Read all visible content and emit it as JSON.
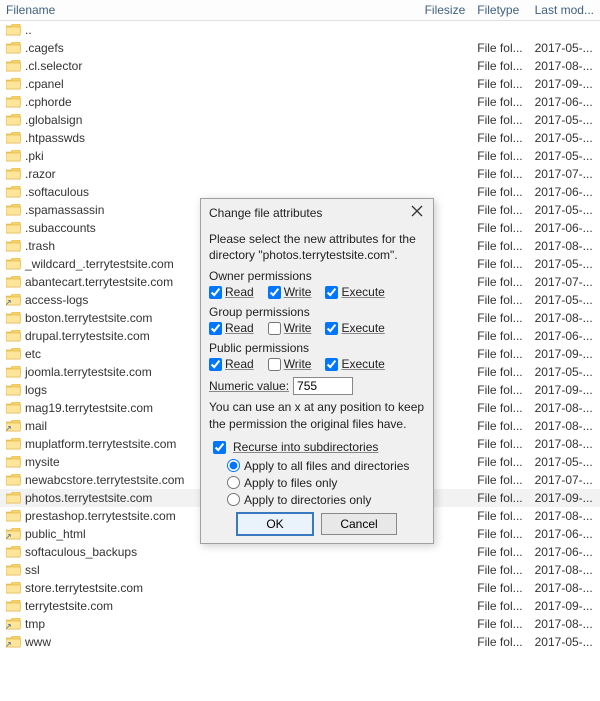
{
  "columns": {
    "filename": "Filename",
    "filesize": "Filesize",
    "filetype": "Filetype",
    "lastmod": "Last mod..."
  },
  "rows": [
    {
      "name": "..",
      "filetype": "",
      "lastmod": "",
      "shortcut": false,
      "selected": false
    },
    {
      "name": ".cagefs",
      "filetype": "File fol...",
      "lastmod": "2017-05-...",
      "shortcut": false,
      "selected": false
    },
    {
      "name": ".cl.selector",
      "filetype": "File fol...",
      "lastmod": "2017-08-...",
      "shortcut": false,
      "selected": false
    },
    {
      "name": ".cpanel",
      "filetype": "File fol...",
      "lastmod": "2017-09-...",
      "shortcut": false,
      "selected": false
    },
    {
      "name": ".cphorde",
      "filetype": "File fol...",
      "lastmod": "2017-06-...",
      "shortcut": false,
      "selected": false
    },
    {
      "name": ".globalsign",
      "filetype": "File fol...",
      "lastmod": "2017-05-...",
      "shortcut": false,
      "selected": false
    },
    {
      "name": ".htpasswds",
      "filetype": "File fol...",
      "lastmod": "2017-05-...",
      "shortcut": false,
      "selected": false
    },
    {
      "name": ".pki",
      "filetype": "File fol...",
      "lastmod": "2017-05-...",
      "shortcut": false,
      "selected": false
    },
    {
      "name": ".razor",
      "filetype": "File fol...",
      "lastmod": "2017-07-...",
      "shortcut": false,
      "selected": false
    },
    {
      "name": ".softaculous",
      "filetype": "File fol...",
      "lastmod": "2017-06-...",
      "shortcut": false,
      "selected": false
    },
    {
      "name": ".spamassassin",
      "filetype": "File fol...",
      "lastmod": "2017-05-...",
      "shortcut": false,
      "selected": false
    },
    {
      "name": ".subaccounts",
      "filetype": "File fol...",
      "lastmod": "2017-06-...",
      "shortcut": false,
      "selected": false
    },
    {
      "name": ".trash",
      "filetype": "File fol...",
      "lastmod": "2017-08-...",
      "shortcut": false,
      "selected": false
    },
    {
      "name": "_wildcard_.terrytestsite.com",
      "filetype": "File fol...",
      "lastmod": "2017-05-...",
      "shortcut": false,
      "selected": false
    },
    {
      "name": "abantecart.terrytestsite.com",
      "filetype": "File fol...",
      "lastmod": "2017-07-...",
      "shortcut": false,
      "selected": false
    },
    {
      "name": "access-logs",
      "filetype": "File fol...",
      "lastmod": "2017-05-...",
      "shortcut": true,
      "selected": false
    },
    {
      "name": "boston.terrytestsite.com",
      "filetype": "File fol...",
      "lastmod": "2017-08-...",
      "shortcut": false,
      "selected": false
    },
    {
      "name": "drupal.terrytestsite.com",
      "filetype": "File fol...",
      "lastmod": "2017-06-...",
      "shortcut": false,
      "selected": false
    },
    {
      "name": "etc",
      "filetype": "File fol...",
      "lastmod": "2017-09-...",
      "shortcut": false,
      "selected": false
    },
    {
      "name": "joomla.terrytestsite.com",
      "filetype": "File fol...",
      "lastmod": "2017-05-...",
      "shortcut": false,
      "selected": false
    },
    {
      "name": "logs",
      "filetype": "File fol...",
      "lastmod": "2017-09-...",
      "shortcut": false,
      "selected": false
    },
    {
      "name": "mag19.terrytestsite.com",
      "filetype": "File fol...",
      "lastmod": "2017-08-...",
      "shortcut": false,
      "selected": false
    },
    {
      "name": "mail",
      "filetype": "File fol...",
      "lastmod": "2017-08-...",
      "shortcut": true,
      "selected": false
    },
    {
      "name": "muplatform.terrytestsite.com",
      "filetype": "File fol...",
      "lastmod": "2017-08-...",
      "shortcut": false,
      "selected": false
    },
    {
      "name": "mysite",
      "filetype": "File fol...",
      "lastmod": "2017-05-...",
      "shortcut": false,
      "selected": false
    },
    {
      "name": "newabcstore.terrytestsite.com",
      "filetype": "File fol...",
      "lastmod": "2017-07-...",
      "shortcut": false,
      "selected": false
    },
    {
      "name": "photos.terrytestsite.com",
      "filetype": "File fol...",
      "lastmod": "2017-09-...",
      "shortcut": false,
      "selected": true
    },
    {
      "name": "prestashop.terrytestsite.com",
      "filetype": "File fol...",
      "lastmod": "2017-08-...",
      "shortcut": false,
      "selected": false
    },
    {
      "name": "public_html",
      "filetype": "File fol...",
      "lastmod": "2017-06-...",
      "shortcut": true,
      "selected": false
    },
    {
      "name": "softaculous_backups",
      "filetype": "File fol...",
      "lastmod": "2017-06-...",
      "shortcut": false,
      "selected": false
    },
    {
      "name": "ssl",
      "filetype": "File fol...",
      "lastmod": "2017-08-...",
      "shortcut": false,
      "selected": false
    },
    {
      "name": "store.terrytestsite.com",
      "filetype": "File fol...",
      "lastmod": "2017-08-...",
      "shortcut": false,
      "selected": false
    },
    {
      "name": "terrytestsite.com",
      "filetype": "File fol...",
      "lastmod": "2017-09-...",
      "shortcut": false,
      "selected": false
    },
    {
      "name": "tmp",
      "filetype": "File fol...",
      "lastmod": "2017-08-...",
      "shortcut": true,
      "selected": false
    },
    {
      "name": "www",
      "filetype": "File fol...",
      "lastmod": "2017-05-...",
      "shortcut": true,
      "selected": false
    }
  ],
  "dialog": {
    "title": "Change file attributes",
    "intro": "Please select the new attributes for the directory \"photos.terrytestsite.com\".",
    "owner_label": "Owner permissions",
    "group_label": "Group permissions",
    "public_label": "Public permissions",
    "perm_read": "Read",
    "perm_write": "Write",
    "perm_execute": "Execute",
    "owner": {
      "read": true,
      "write": true,
      "execute": true
    },
    "group": {
      "read": true,
      "write": false,
      "execute": true
    },
    "public": {
      "read": true,
      "write": false,
      "execute": true
    },
    "numeric_label": "Numeric value:",
    "numeric_value": "755",
    "hint": "You can use an x at any position to keep the permission the original files have.",
    "recurse_label": "Recurse into subdirectories",
    "recurse_checked": true,
    "radio_all": "Apply to all files and directories",
    "radio_files": "Apply to files only",
    "radio_dirs": "Apply to directories only",
    "radio_selected": "all",
    "ok": "OK",
    "cancel": "Cancel"
  }
}
